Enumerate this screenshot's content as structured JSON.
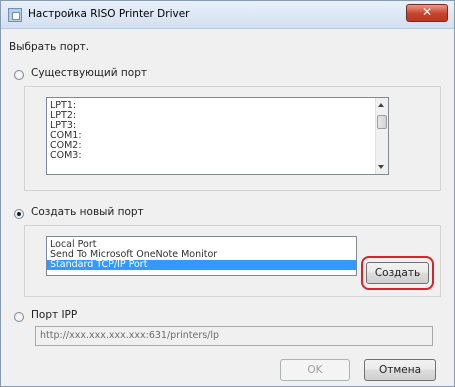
{
  "window": {
    "title": "Настройка RISO Printer Driver",
    "close_symbol": "✕"
  },
  "heading": "Выбрать порт.",
  "existing": {
    "label": "Существующий  порт",
    "selected": false,
    "items": [
      "LPT1:",
      "LPT2:",
      "LPT3:",
      "COM1:",
      "COM2:",
      "COM3:"
    ]
  },
  "new_port": {
    "label": "Создать  новый порт",
    "selected": true,
    "items": [
      "Local Port",
      "Send To Microsoft OneNote Monitor",
      "Standard TCP/IP Port"
    ],
    "selected_item": "Standard TCP/IP Port",
    "create_label": "Создать"
  },
  "ipp": {
    "label": "Порт IPP",
    "selected": false,
    "url": "http://xxx.xxx.xxx.xxx:631/printers/lp"
  },
  "buttons": {
    "ok": "OK",
    "cancel": "Отмена"
  },
  "colors": {
    "selection": "#3399ff",
    "highlight_ring": "#d8232a",
    "close_button": "#c8412b"
  }
}
